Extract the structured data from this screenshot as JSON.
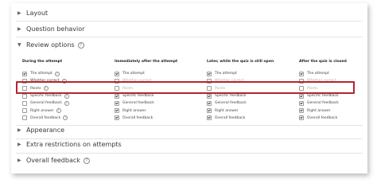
{
  "sections": {
    "layout": "Layout",
    "question_behavior": "Question behavior",
    "review_options": "Review options",
    "appearance": "Appearance",
    "extra_restrictions": "Extra restrictions on attempts",
    "overall_feedback": "Overall feedback"
  },
  "columns": [
    {
      "title": "During the attempt",
      "rows": [
        {
          "label": "The attempt",
          "checked": true,
          "dim": false,
          "help": true
        },
        {
          "label": "Whether correct",
          "checked": false,
          "dim": false,
          "help": true
        },
        {
          "label": "Points",
          "checked": false,
          "dim": false,
          "help": true
        },
        {
          "label": "Specific feedback",
          "checked": false,
          "dim": false,
          "help": true
        },
        {
          "label": "General feedback",
          "checked": false,
          "dim": false,
          "help": true
        },
        {
          "label": "Right answer",
          "checked": false,
          "dim": false,
          "help": true
        },
        {
          "label": "Overall feedback",
          "checked": false,
          "dim": false,
          "help": true
        }
      ]
    },
    {
      "title": "Immediately after the attempt",
      "rows": [
        {
          "label": "The attempt",
          "checked": true,
          "dim": false,
          "help": false
        },
        {
          "label": "Whether correct",
          "checked": false,
          "dim": true,
          "help": false
        },
        {
          "label": "Points",
          "checked": false,
          "dim": true,
          "help": false
        },
        {
          "label": "Specific feedback",
          "checked": true,
          "dim": false,
          "help": false
        },
        {
          "label": "General feedback",
          "checked": true,
          "dim": false,
          "help": false
        },
        {
          "label": "Right answer",
          "checked": true,
          "dim": false,
          "help": false
        },
        {
          "label": "Overall feedback",
          "checked": true,
          "dim": false,
          "help": false
        }
      ]
    },
    {
      "title": "Later, while the quiz is still open",
      "rows": [
        {
          "label": "The attempt",
          "checked": true,
          "dim": false,
          "help": false
        },
        {
          "label": "Whether correct",
          "checked": false,
          "dim": true,
          "help": false
        },
        {
          "label": "Points",
          "checked": false,
          "dim": true,
          "help": false
        },
        {
          "label": "Specific feedback",
          "checked": true,
          "dim": false,
          "help": false
        },
        {
          "label": "General feedback",
          "checked": true,
          "dim": false,
          "help": false
        },
        {
          "label": "Right answer",
          "checked": true,
          "dim": false,
          "help": false
        },
        {
          "label": "Overall feedback",
          "checked": true,
          "dim": false,
          "help": false
        }
      ]
    },
    {
      "title": "After the quiz is closed",
      "rows": [
        {
          "label": "The attempt",
          "checked": true,
          "dim": false,
          "help": false
        },
        {
          "label": "Whether correct",
          "checked": false,
          "dim": true,
          "help": false
        },
        {
          "label": "Points",
          "checked": false,
          "dim": true,
          "help": false
        },
        {
          "label": "Specific feedback",
          "checked": true,
          "dim": false,
          "help": false
        },
        {
          "label": "General feedback",
          "checked": true,
          "dim": false,
          "help": false
        },
        {
          "label": "Right answer",
          "checked": true,
          "dim": false,
          "help": false
        },
        {
          "label": "Overall feedback",
          "checked": true,
          "dim": false,
          "help": false
        }
      ]
    }
  ],
  "colors": {
    "highlight": "#b3262d",
    "shadow": "#000000"
  }
}
